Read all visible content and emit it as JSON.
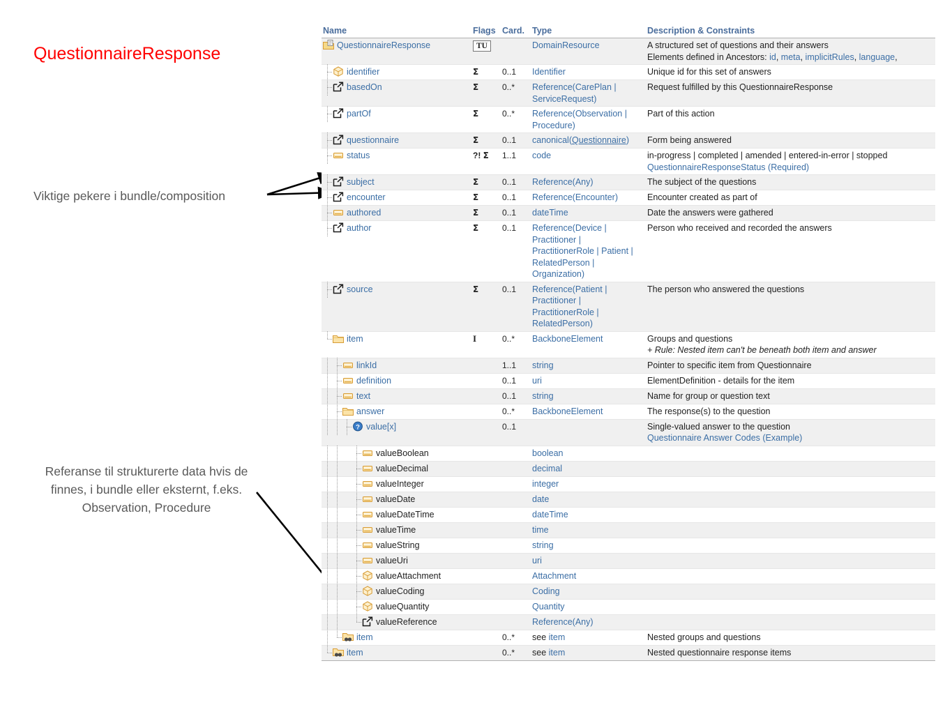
{
  "slide": {
    "title": "QuestionnaireResponse",
    "title_color": "#ff0000",
    "annotations": [
      {
        "id": "pointers",
        "text": "Viktige pekere i bundle/composition"
      },
      {
        "id": "reference",
        "text": "Referanse til strukturerte data hvis de finnes, i bundle eller eksternt, f.eks. Observation, Procedure"
      }
    ]
  },
  "table": {
    "headers": {
      "name": "Name",
      "flags": "Flags",
      "card": "Card.",
      "type": "Type",
      "description": "Description & Constraints"
    },
    "rows": [
      {
        "depth": 0,
        "icon": "resource-folder-icon",
        "name": "QuestionnaireResponse",
        "name_link": true,
        "flags_badge": "TU",
        "flags": "",
        "card": "",
        "type": "DomainResource",
        "type_link": true,
        "desc_lines": [
          "A structured set of questions and their answers",
          "Elements defined in Ancestors: id, meta, implicitRules, language,"
        ]
      },
      {
        "depth": 1,
        "icon": "datatype-cube-icon",
        "name": "identifier",
        "name_link": true,
        "flags": "Σ",
        "card": "0..1",
        "type": "Identifier",
        "type_link": true,
        "desc_lines": [
          "Unique id for this set of answers"
        ]
      },
      {
        "depth": 1,
        "icon": "reference-icon",
        "name": "basedOn",
        "name_link": true,
        "flags": "Σ",
        "card": "0..*",
        "type": "Reference(CarePlan | ServiceRequest)",
        "type_link": true,
        "desc_lines": [
          "Request fulfilled by this QuestionnaireResponse"
        ]
      },
      {
        "depth": 1,
        "icon": "reference-icon",
        "name": "partOf",
        "name_link": true,
        "flags": "Σ",
        "card": "0..*",
        "type": "Reference(Observation | Procedure)",
        "type_link": true,
        "desc_lines": [
          "Part of this action"
        ]
      },
      {
        "depth": 1,
        "icon": "reference-icon",
        "name": "questionnaire",
        "name_link": true,
        "flags": "Σ",
        "card": "0..1",
        "type": "canonical(Questionnaire)",
        "type_link": true,
        "desc_lines": [
          "Form being answered"
        ]
      },
      {
        "depth": 1,
        "icon": "primitive-icon",
        "name": "status",
        "name_link": true,
        "flags": "?! Σ",
        "card": "1..1",
        "type": "code",
        "type_link": true,
        "desc_lines": [
          "in-progress | completed | amended | entered-in-error | stopped",
          "QuestionnaireResponseStatus (Required)"
        ]
      },
      {
        "depth": 1,
        "icon": "reference-icon",
        "name": "subject",
        "name_link": true,
        "flags": "Σ",
        "card": "0..1",
        "type": "Reference(Any)",
        "type_link": true,
        "desc_lines": [
          "The subject of the questions"
        ]
      },
      {
        "depth": 1,
        "icon": "reference-icon",
        "name": "encounter",
        "name_link": true,
        "flags": "Σ",
        "card": "0..1",
        "type": "Reference(Encounter)",
        "type_link": true,
        "desc_lines": [
          "Encounter created as part of"
        ]
      },
      {
        "depth": 1,
        "icon": "primitive-icon",
        "name": "authored",
        "name_link": true,
        "flags": "Σ",
        "card": "0..1",
        "type": "dateTime",
        "type_link": true,
        "desc_lines": [
          "Date the answers were gathered"
        ]
      },
      {
        "depth": 1,
        "icon": "reference-icon",
        "name": "author",
        "name_link": true,
        "flags": "Σ",
        "card": "0..1",
        "type": "Reference(Device | Practitioner | PractitionerRole | Patient | RelatedPerson | Organization)",
        "type_link": true,
        "desc_lines": [
          "Person who received and recorded the answers"
        ]
      },
      {
        "depth": 1,
        "icon": "reference-icon",
        "name": "source",
        "name_link": true,
        "flags": "Σ",
        "card": "0..1",
        "type": "Reference(Patient | Practitioner | PractitionerRole | RelatedPerson)",
        "type_link": true,
        "desc_lines": [
          "The person who answered the questions"
        ]
      },
      {
        "depth": 1,
        "icon": "backbone-folder-icon",
        "name": "item",
        "name_link": true,
        "last_at_depth": true,
        "flags": "I",
        "card": "0..*",
        "type": "BackboneElement",
        "type_link": true,
        "desc_lines": [
          "Groups and questions",
          "+ Rule: Nested item can't be beneath both item and answer"
        ],
        "desc_italic_lines": [
          1
        ]
      },
      {
        "depth": 2,
        "icon": "primitive-icon",
        "name": "linkId",
        "name_link": true,
        "flags": "",
        "card": "1..1",
        "type": "string",
        "type_link": true,
        "desc_lines": [
          "Pointer to specific item from Questionnaire"
        ]
      },
      {
        "depth": 2,
        "icon": "primitive-icon",
        "name": "definition",
        "name_link": true,
        "flags": "",
        "card": "0..1",
        "type": "uri",
        "type_link": true,
        "desc_lines": [
          "ElementDefinition - details for the item"
        ]
      },
      {
        "depth": 2,
        "icon": "primitive-icon",
        "name": "text",
        "name_link": true,
        "flags": "",
        "card": "0..1",
        "type": "string",
        "type_link": true,
        "desc_lines": [
          "Name for group or question text"
        ]
      },
      {
        "depth": 2,
        "icon": "backbone-folder-icon",
        "name": "answer",
        "name_link": true,
        "flags": "",
        "card": "0..*",
        "type": "BackboneElement",
        "type_link": true,
        "desc_lines": [
          "The response(s) to the question"
        ]
      },
      {
        "depth": 3,
        "icon": "choice-icon",
        "name": "value[x]",
        "name_link": true,
        "flags": "",
        "card": "0..1",
        "type": "",
        "type_link": false,
        "desc_lines": [
          "Single-valued answer to the question",
          "Questionnaire Answer Codes (Example)"
        ],
        "desc_link_lines": [
          1
        ]
      },
      {
        "depth": 4,
        "icon": "primitive-icon",
        "name": "valueBoolean",
        "name_link": false,
        "flags": "",
        "card": "",
        "type": "boolean",
        "type_link": true,
        "desc_lines": []
      },
      {
        "depth": 4,
        "icon": "primitive-icon",
        "name": "valueDecimal",
        "name_link": false,
        "flags": "",
        "card": "",
        "type": "decimal",
        "type_link": true,
        "desc_lines": []
      },
      {
        "depth": 4,
        "icon": "primitive-icon",
        "name": "valueInteger",
        "name_link": false,
        "flags": "",
        "card": "",
        "type": "integer",
        "type_link": true,
        "desc_lines": []
      },
      {
        "depth": 4,
        "icon": "primitive-icon",
        "name": "valueDate",
        "name_link": false,
        "flags": "",
        "card": "",
        "type": "date",
        "type_link": true,
        "desc_lines": []
      },
      {
        "depth": 4,
        "icon": "primitive-icon",
        "name": "valueDateTime",
        "name_link": false,
        "flags": "",
        "card": "",
        "type": "dateTime",
        "type_link": true,
        "desc_lines": []
      },
      {
        "depth": 4,
        "icon": "primitive-icon",
        "name": "valueTime",
        "name_link": false,
        "flags": "",
        "card": "",
        "type": "time",
        "type_link": true,
        "desc_lines": []
      },
      {
        "depth": 4,
        "icon": "primitive-icon",
        "name": "valueString",
        "name_link": false,
        "flags": "",
        "card": "",
        "type": "string",
        "type_link": true,
        "desc_lines": []
      },
      {
        "depth": 4,
        "icon": "primitive-icon",
        "name": "valueUri",
        "name_link": false,
        "flags": "",
        "card": "",
        "type": "uri",
        "type_link": true,
        "desc_lines": []
      },
      {
        "depth": 4,
        "icon": "datatype-cube-icon",
        "name": "valueAttachment",
        "name_link": false,
        "flags": "",
        "card": "",
        "type": "Attachment",
        "type_link": true,
        "desc_lines": []
      },
      {
        "depth": 4,
        "icon": "datatype-cube-icon",
        "name": "valueCoding",
        "name_link": false,
        "flags": "",
        "card": "",
        "type": "Coding",
        "type_link": true,
        "desc_lines": []
      },
      {
        "depth": 4,
        "icon": "datatype-cube-icon",
        "name": "valueQuantity",
        "name_link": false,
        "flags": "",
        "card": "",
        "type": "Quantity",
        "type_link": true,
        "desc_lines": []
      },
      {
        "depth": 4,
        "icon": "reference-icon",
        "name": "valueReference",
        "name_link": false,
        "last_at_depth": true,
        "flags": "",
        "card": "",
        "type": "Reference(Any)",
        "type_link": true,
        "desc_lines": []
      },
      {
        "depth": 2,
        "icon": "nested-item-icon",
        "name": "item",
        "name_link": true,
        "last_at_depth": true,
        "flags": "",
        "card": "0..*",
        "type": "see item",
        "type_link": "partial",
        "desc_lines": [
          "Nested groups and questions"
        ]
      },
      {
        "depth": 1,
        "icon": "nested-item-icon",
        "name": "item",
        "name_link": true,
        "last_at_depth": true,
        "flags": "",
        "card": "0..*",
        "type": "see item",
        "type_link": "partial",
        "desc_lines": [
          "Nested questionnaire response items"
        ]
      }
    ]
  },
  "icons": {
    "resource-folder-icon": "resource",
    "datatype-cube-icon": "datatype",
    "reference-icon": "reference",
    "primitive-icon": "primitive",
    "backbone-folder-icon": "backbone",
    "choice-icon": "choice",
    "nested-item-icon": "nested"
  },
  "colors": {
    "link": "#3b6ea5",
    "header": "#4a6d9c",
    "title": "#ff0000",
    "annotation": "#595959",
    "row_alt": "#f0f0f0"
  }
}
